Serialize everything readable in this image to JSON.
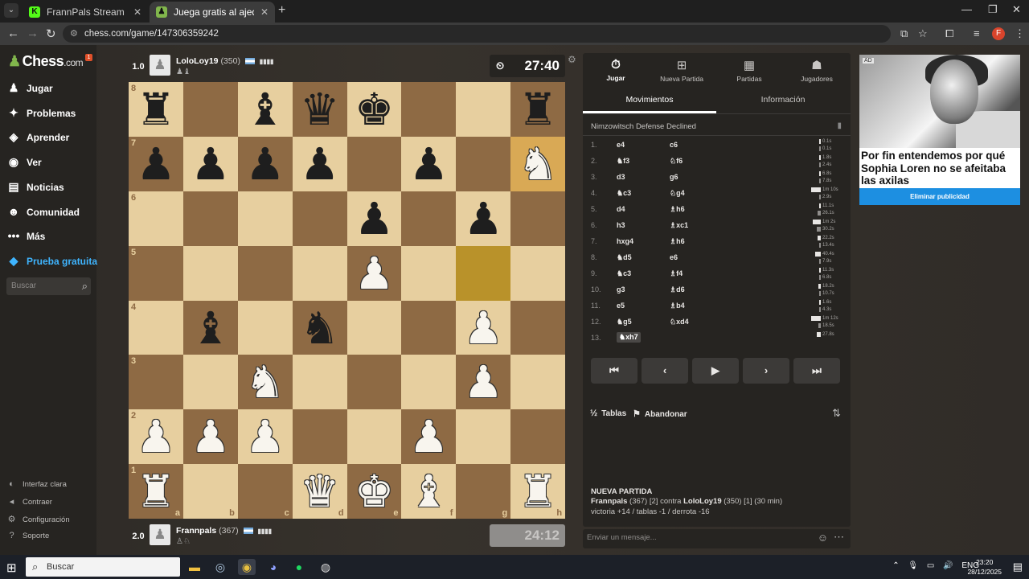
{
  "browser": {
    "tabs": [
      {
        "title": "FrannPals Stream - Watch Live o",
        "active": false,
        "fav_color": "#53fc18",
        "fav_text": "K"
      },
      {
        "title": "Juega gratis al ajedrez online c",
        "active": true,
        "fav_color": "#81b64c",
        "fav_text": "♟"
      }
    ],
    "url": "chess.com/game/147306359242",
    "profile_initial": "F"
  },
  "sidebar": {
    "logo": "Chess",
    "logo_suffix": ".com",
    "badge": "1",
    "items": [
      {
        "label": "Jugar",
        "icon": "♟",
        "color": "#ffffff"
      },
      {
        "label": "Problemas",
        "icon": "✦",
        "color": "#ffffff"
      },
      {
        "label": "Aprender",
        "icon": "◈",
        "color": "#ffffff"
      },
      {
        "label": "Ver",
        "icon": "◉",
        "color": "#ffffff"
      },
      {
        "label": "Noticias",
        "icon": "▤",
        "color": "#ffffff"
      },
      {
        "label": "Comunidad",
        "icon": "☻",
        "color": "#ffffff"
      },
      {
        "label": "Más",
        "icon": "•••",
        "color": "#ffffff"
      },
      {
        "label": "Prueba gratuita",
        "icon": "◆",
        "color": "#3fb5ff"
      }
    ],
    "search_placeholder": "Buscar",
    "footer": [
      {
        "label": "Interfaz clara",
        "icon": "◐"
      },
      {
        "label": "Contraer",
        "icon": "◂"
      },
      {
        "label": "Configuración",
        "icon": "⚙"
      },
      {
        "label": "Soporte",
        "icon": "?"
      }
    ]
  },
  "top_player": {
    "score": "1.0",
    "name": "LoloLoy19",
    "rating": "(350)",
    "captured": "♟♝",
    "clock": "27:40",
    "clock_icon": "⏲"
  },
  "bottom_player": {
    "score": "2.0",
    "name": "Frannpals",
    "rating": "(367)",
    "captured": "♙♘",
    "clock": "24:12"
  },
  "board": {
    "ranks": [
      "8",
      "7",
      "6",
      "5",
      "4",
      "3",
      "2",
      "1"
    ],
    "files": [
      "a",
      "b",
      "c",
      "d",
      "e",
      "f",
      "g",
      "h"
    ],
    "position": [
      [
        "bR",
        "",
        "bB",
        "bQ",
        "bK",
        "",
        "",
        "bR"
      ],
      [
        "bP",
        "bP",
        "bP",
        "bP",
        "",
        "bP",
        "",
        "wN"
      ],
      [
        "",
        "",
        "",
        "",
        "bP",
        "",
        "bP",
        ""
      ],
      [
        "",
        "",
        "",
        "",
        "wP",
        "",
        "",
        ""
      ],
      [
        "",
        "bB",
        "",
        "bN",
        "",
        "",
        "wP",
        ""
      ],
      [
        "",
        "",
        "wN",
        "",
        "",
        "",
        "wP",
        ""
      ],
      [
        "wP",
        "wP",
        "wP",
        "",
        "",
        "wP",
        "",
        ""
      ],
      [
        "wR",
        "",
        "",
        "wQ",
        "wK",
        "wB",
        "",
        "wR"
      ]
    ],
    "highlight_from": "g5",
    "highlight_to": "h7"
  },
  "panel": {
    "tabs": [
      {
        "label": "Jugar",
        "icon": "⏱",
        "active": true
      },
      {
        "label": "Nueva Partida",
        "icon": "⊞",
        "active": false
      },
      {
        "label": "Partidas",
        "icon": "▦",
        "active": false
      },
      {
        "label": "Jugadores",
        "icon": "☗",
        "active": false
      }
    ],
    "subtabs": [
      "Movimientos",
      "Información"
    ],
    "opening": "Nimzowitsch Defense Declined",
    "moves": [
      {
        "n": "1.",
        "w": "e4",
        "b": "c6",
        "tw": "0.1s",
        "tb": "0.1s"
      },
      {
        "n": "2.",
        "w": "♞f3",
        "b": "♘f6",
        "tw": "1.8s",
        "tb": "2.4s"
      },
      {
        "n": "3.",
        "w": "d3",
        "b": "g6",
        "tw": "6.8s",
        "tb": "7.8s"
      },
      {
        "n": "4.",
        "w": "♞c3",
        "b": "♘g4",
        "tw": "1m 10s",
        "tb": "2.9s"
      },
      {
        "n": "5.",
        "w": "d4",
        "b": "♗h6",
        "tw": "11.1s",
        "tb": "26.1s"
      },
      {
        "n": "6.",
        "w": "h3",
        "b": "♗xc1",
        "tw": "1m 2s",
        "tb": "30.2s"
      },
      {
        "n": "7.",
        "w": "hxg4",
        "b": "♗h6",
        "tw": "22.2s",
        "tb": "13.4s"
      },
      {
        "n": "8.",
        "w": "♞d5",
        "b": "e6",
        "tw": "40.4s",
        "tb": "7.9s"
      },
      {
        "n": "9.",
        "w": "♞c3",
        "b": "♗f4",
        "tw": "11.3s",
        "tb": "6.8s"
      },
      {
        "n": "10.",
        "w": "g3",
        "b": "♗d6",
        "tw": "18.2s",
        "tb": "10.7s"
      },
      {
        "n": "11.",
        "w": "e5",
        "b": "♗b4",
        "tw": "1.6s",
        "tb": "4.3s"
      },
      {
        "n": "12.",
        "w": "♞g5",
        "b": "♘xd4",
        "tw": "1m 12s",
        "tb": "18.5s"
      },
      {
        "n": "13.",
        "w": "♞xh7",
        "b": "",
        "tw": "27.8s",
        "tb": ""
      }
    ],
    "controls": [
      "⏮",
      "‹",
      "▶",
      "›",
      "⏭"
    ],
    "actions": [
      {
        "label": "Tablas",
        "icon": "½"
      },
      {
        "label": "Abandonar",
        "icon": "⚑"
      }
    ],
    "new_game": {
      "title": "NUEVA PARTIDA",
      "line1_a": "Frannpals",
      "line1_b": "(367) [2] contra",
      "line1_c": "LoloLoy19",
      "line1_d": "(350) [1] (30 min)",
      "line2": "victoria +14 / tablas -1 / derrota -16"
    },
    "chat_placeholder": "Enviar un mensaje..."
  },
  "ad": {
    "tag": "AD",
    "headline": "Por fin entendemos por qué Sophia Loren no se afeitaba las axilas",
    "button": "Eliminar publicidad"
  },
  "taskbar": {
    "search": "Buscar",
    "lang": "ENG",
    "time": "23:20",
    "date": "28/12/2025"
  }
}
